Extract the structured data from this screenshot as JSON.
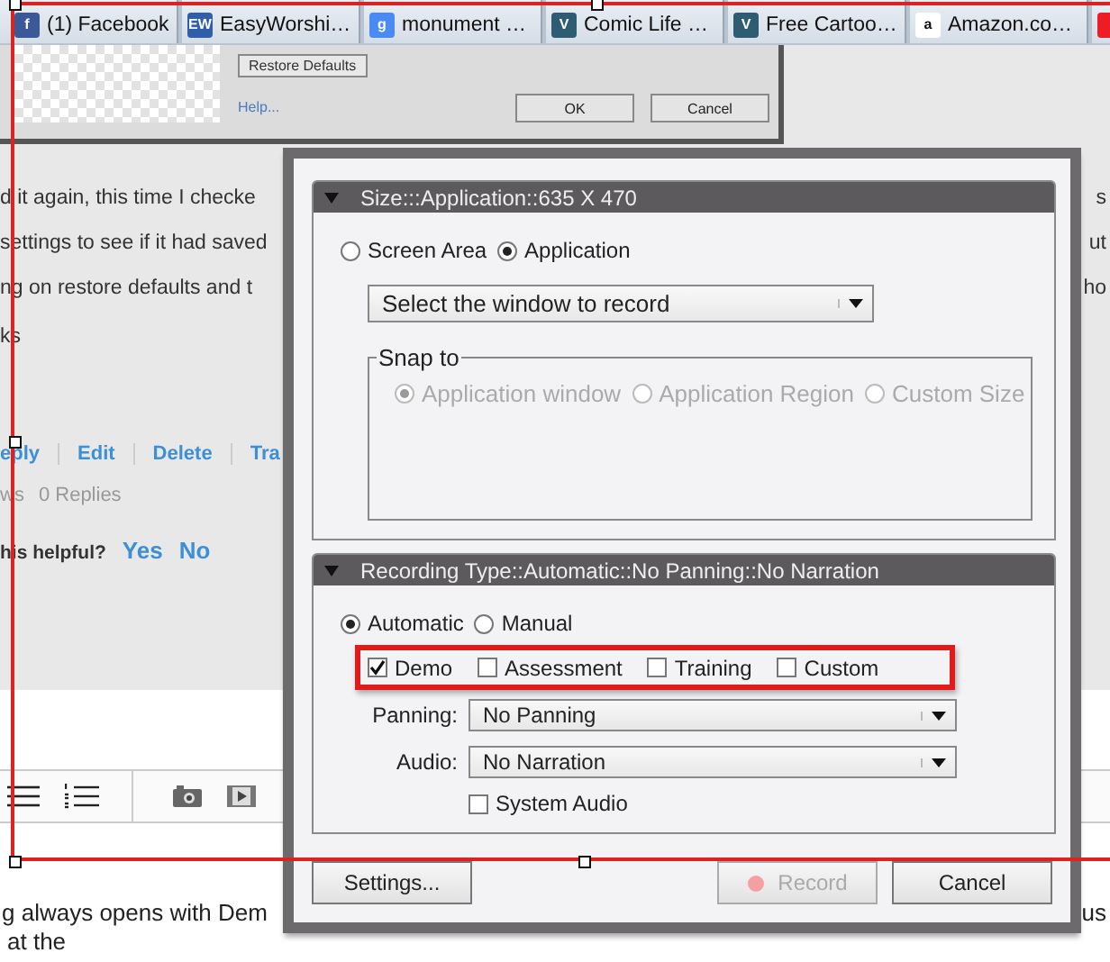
{
  "browser_tabs": [
    {
      "logo": "f",
      "label": "(1) Facebook",
      "color": "#3b5998"
    },
    {
      "logo": "EW",
      "label": "EasyWorshi…",
      "color": "#2f5fa8"
    },
    {
      "logo": "g",
      "label": "monument …",
      "color": "#4a8af4"
    },
    {
      "logo": "V",
      "label": "Comic Life …",
      "color": "#2e5c73"
    },
    {
      "logo": "V",
      "label": "Free Cartoo…",
      "color": "#2e5c73"
    },
    {
      "logo": "a",
      "label": "Amazon.co…",
      "color": "#ffffff"
    },
    {
      "color": "#ee1c24"
    }
  ],
  "back_dialog": {
    "restore_button": "Restore Defaults",
    "help_link": "Help...",
    "buttons": [
      "OK",
      "Cancel"
    ]
  },
  "page": {
    "lines": [
      {
        "left": "d it again, this time I checke",
        "right": "s"
      },
      {
        "left": "settings to see if it had saved",
        "right": "ut"
      },
      {
        "left": "ng on restore defaults and t",
        "right": "ho"
      },
      {
        "left": "ks"
      }
    ],
    "actions": [
      "eply",
      "Edit",
      "Delete",
      "Tra"
    ],
    "stats": [
      "ws",
      "0 Replies"
    ],
    "helpful": {
      "question": "his helpful?",
      "options": [
        "Yes",
        "No"
      ]
    },
    "footer_lines": [
      {
        "left": "g always opens with Dem",
        "right": "us"
      },
      {
        "left": "at the"
      }
    ]
  },
  "dialog": {
    "size_section": {
      "title": "Size:::Application::635 X 470",
      "expanded": true,
      "modes": [
        {
          "label": "Screen Area",
          "selected": false
        },
        {
          "label": "Application",
          "selected": true
        }
      ],
      "window_select": "Select the window to record",
      "snap": {
        "title": "Snap to",
        "disabled": true,
        "options": [
          {
            "label": "Application window",
            "selected": true
          },
          {
            "label": "Application Region",
            "selected": false
          },
          {
            "label": "Custom Size",
            "selected": false
          }
        ]
      }
    },
    "recording_section": {
      "title": "Recording Type::Automatic::No Panning::No Narration",
      "expanded": true,
      "modes": [
        {
          "label": "Automatic",
          "selected": true
        },
        {
          "label": "Manual",
          "selected": false
        }
      ],
      "types": [
        {
          "label": "Demo",
          "checked": true
        },
        {
          "label": "Assessment",
          "checked": false
        },
        {
          "label": "Training",
          "checked": false
        },
        {
          "label": "Custom",
          "checked": false
        }
      ],
      "panning": {
        "label": "Panning:",
        "value": "No Panning"
      },
      "audio": {
        "label": "Audio:",
        "value": "No Narration"
      },
      "system_audio": {
        "label": "System Audio",
        "checked": false
      }
    },
    "buttons": [
      {
        "label": "Settings...",
        "disabled": false,
        "kind": "plain"
      },
      {
        "label": "Record",
        "disabled": true,
        "kind": "record"
      },
      {
        "label": "Cancel",
        "disabled": false,
        "kind": "plain"
      }
    ]
  }
}
